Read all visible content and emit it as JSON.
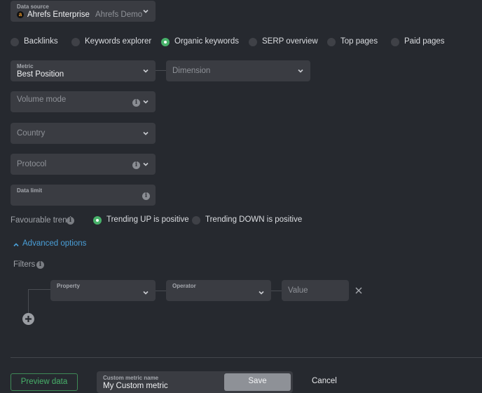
{
  "data_source": {
    "label": "Data source",
    "value": "Ahrefs Enterprise",
    "sub": "Ahrefs Demo",
    "logo_letter": "a"
  },
  "source_tabs": [
    {
      "label": "Backlinks",
      "selected": false
    },
    {
      "label": "Keywords explorer",
      "selected": false
    },
    {
      "label": "Organic keywords",
      "selected": true
    },
    {
      "label": "SERP overview",
      "selected": false
    },
    {
      "label": "Top pages",
      "selected": false
    },
    {
      "label": "Paid pages",
      "selected": false
    }
  ],
  "metric": {
    "label": "Metric",
    "value": "Best Position"
  },
  "dimension": {
    "placeholder": "Dimension"
  },
  "volume_mode": {
    "placeholder": "Volume mode"
  },
  "country": {
    "placeholder": "Country"
  },
  "protocol": {
    "placeholder": "Protocol"
  },
  "data_limit": {
    "label": "Data limit",
    "value": ""
  },
  "favourable_trend": {
    "label": "Favourable trend",
    "options": [
      {
        "label": "Trending UP is positive",
        "selected": true
      },
      {
        "label": "Trending DOWN is positive",
        "selected": false
      }
    ]
  },
  "advanced_options": {
    "label": "Advanced options",
    "expanded": true
  },
  "filters": {
    "label": "Filters",
    "property": {
      "label": "Property",
      "value": ""
    },
    "operator": {
      "label": "Operator",
      "value": ""
    },
    "value": {
      "placeholder": "Value"
    }
  },
  "footer": {
    "preview_label": "Preview data",
    "custom_metric_label": "Custom metric name",
    "custom_metric_value": "My Custom metric",
    "save_label": "Save",
    "cancel_label": "Cancel"
  },
  "colors": {
    "accent_green": "#48b16a",
    "link_blue": "#4a9fd8",
    "background": "#26292f",
    "field": "#3a3c42"
  }
}
